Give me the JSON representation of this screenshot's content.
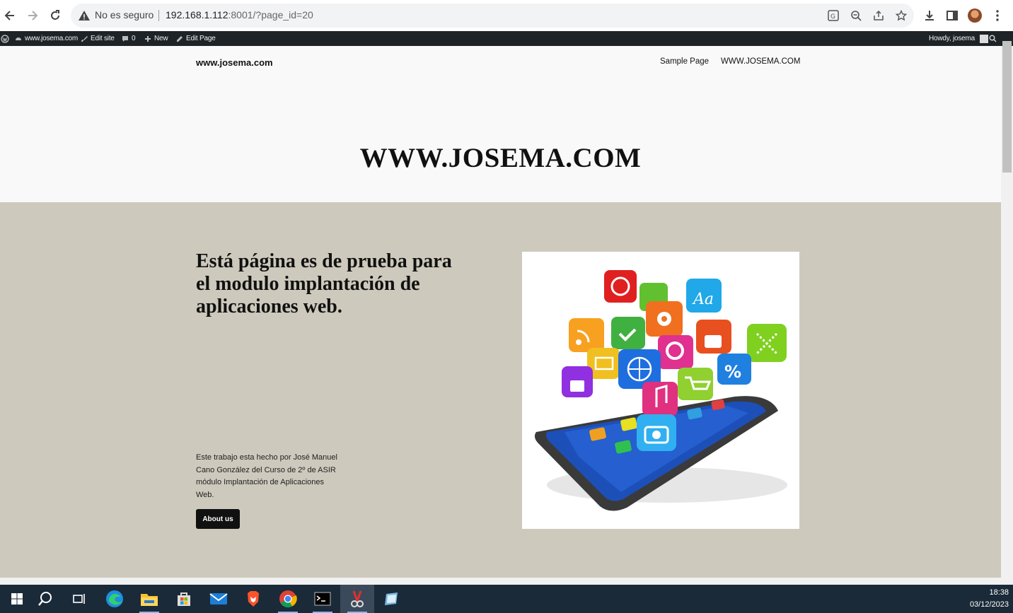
{
  "browser": {
    "security_label": "No es seguro",
    "url_host": "192.168.1.112",
    "url_rest": ":8001/?page_id=20"
  },
  "admin_bar": {
    "site": "www.josema.com",
    "edit_site": "Edit site",
    "comments_count": "0",
    "new": "New",
    "edit_page": "Edit Page",
    "howdy": "Howdy, josema"
  },
  "site": {
    "title": "www.josema.com",
    "nav": [
      "Sample Page",
      "WWW.JOSEMA.COM"
    ],
    "hero_title": "WWW.JOSEMA.COM"
  },
  "content": {
    "heading": "Está página es de prueba para el modulo implantación de aplicaciones web.",
    "paragraph": "Este trabajo esta hecho por José Manuel Cano González del Curso de 2º de ASIR módulo Implantación de Aplicaciones Web.",
    "button": "About us"
  },
  "taskbar": {
    "time": "18:38",
    "date": "03/12/2023"
  },
  "colors": {
    "band": "#cdc9bc",
    "admin_bar": "#1d2327",
    "taskbar": "#1b2a39"
  }
}
